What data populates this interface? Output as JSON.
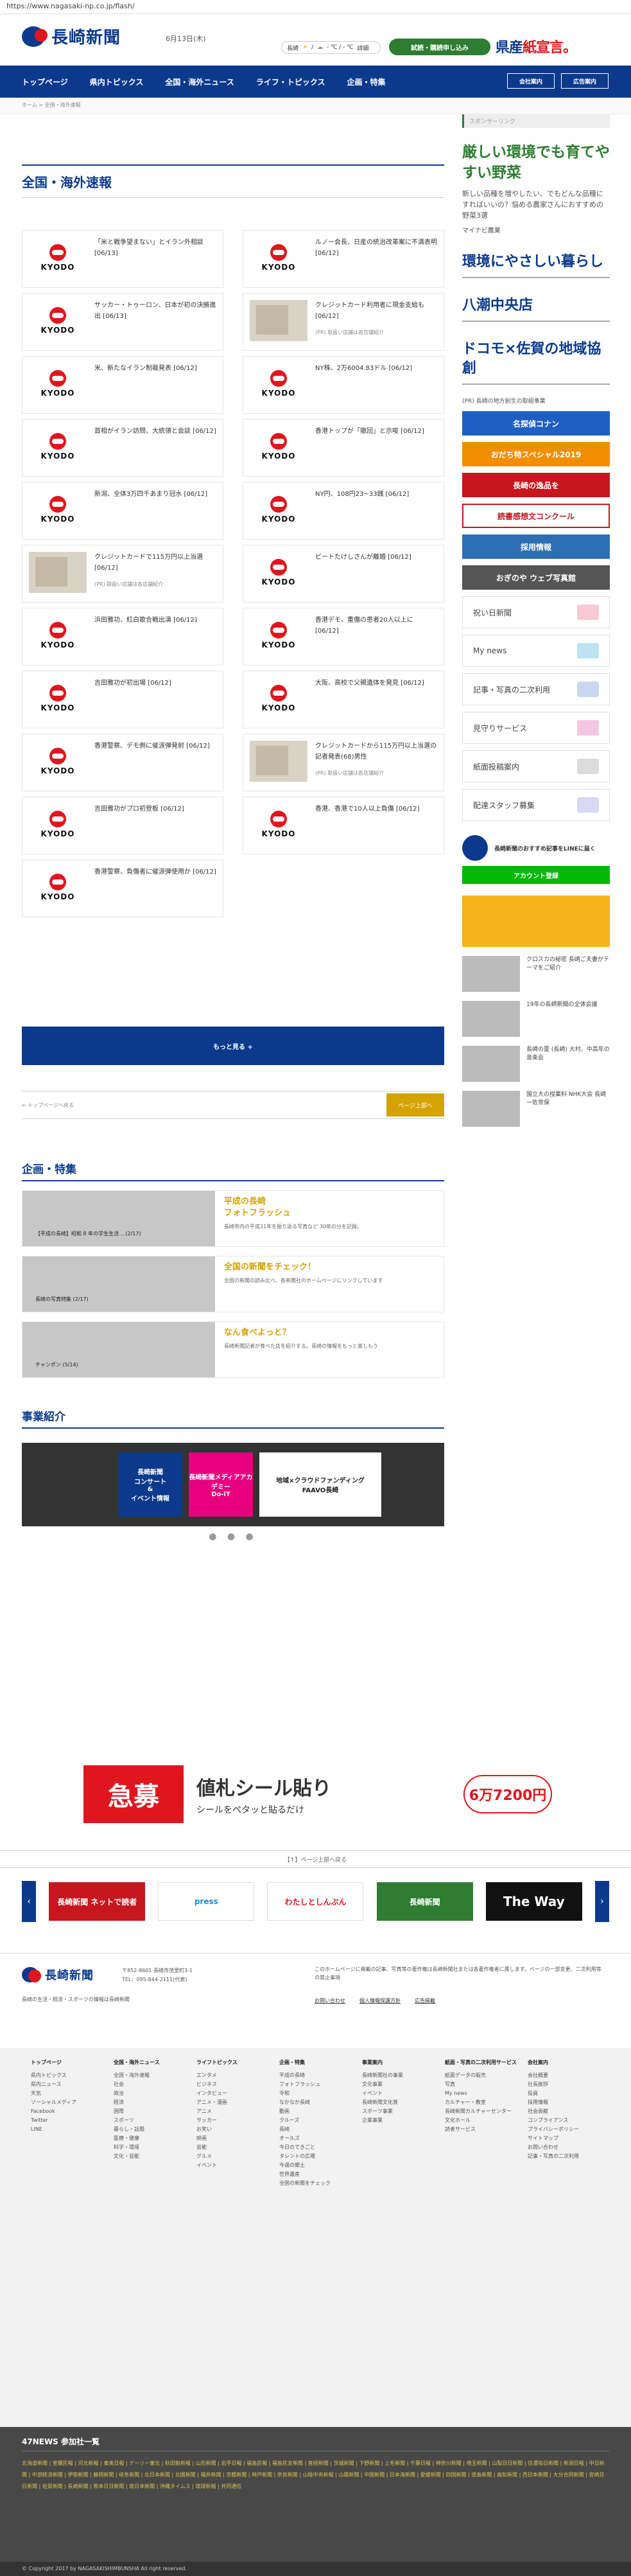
{
  "browser": {
    "url": "https://www.nagasaki-np.co.jp/flash/"
  },
  "header": {
    "logo": "長崎新聞",
    "date": "6月13日(木)",
    "weather": {
      "city": "長崎",
      "sun": "☀",
      "sep": "/",
      "cloud": "☁",
      "temp": "- ℃ / - ℃",
      "link": "詳細"
    },
    "trial": "試読・購読申し込み",
    "kenyo_a": "県産",
    "kenyo_b": "紙宣言。"
  },
  "nav": {
    "items": [
      "トップページ",
      "県内トピックス",
      "全国・海外ニュース",
      "ライフ・トピックス",
      "企画・特集"
    ],
    "company": "会社案内",
    "ad_info": "広告案内"
  },
  "breadcrumb": "ホーム > 全国・海外速報",
  "section": {
    "title": "全国・海外速報"
  },
  "kyodo_word": "KYODO",
  "articles": [
    {
      "title": "「米と戦争望まない」とイラン外相談 [06/13]",
      "kind": "kyodo"
    },
    {
      "title": "ルノー会長、日産の統治改革案に不満表明 [06/12]",
      "kind": "kyodo"
    },
    {
      "title": "サッカー・トゥーロン、日本が初の決勝進出 [06/13]",
      "kind": "kyodo"
    },
    {
      "title": "クレジットカード利用者に現金支給も [06/12]",
      "kind": "photo",
      "note": "(PR) 取扱い店舗は各店舗紹介"
    },
    {
      "title": "米、新たなイラン制裁発表 [06/12]",
      "kind": "kyodo"
    },
    {
      "title": "NY株、2万6004.83ドル [06/12]",
      "kind": "kyodo"
    },
    {
      "title": "首相がイラン訪問、大統領と会談 [06/12]",
      "kind": "kyodo"
    },
    {
      "title": "香港トップが「撤回」と示唆 [06/12]",
      "kind": "kyodo"
    },
    {
      "title": "新潟、全体3万四千あまり冠水 [06/12]",
      "kind": "kyodo"
    },
    {
      "title": "NY円、108円23~33銭 [06/12]",
      "kind": "kyodo"
    },
    {
      "title": "クレジットカードで115万円以上当選 [06/12]",
      "kind": "photo",
      "note": "(PR) 取扱い店舗は各店舗紹介"
    },
    {
      "title": "ビートたけしさんが離婚 [06/12]",
      "kind": "kyodo"
    },
    {
      "title": "浜田雅功、紅白歌合戦出演 [06/12]",
      "kind": "kyodo"
    },
    {
      "title": "香港デモ、重傷の患者20人以上に [06/12]",
      "kind": "kyodo"
    },
    {
      "title": "吉田雅功が初出場 [06/12]",
      "kind": "kyodo"
    },
    {
      "title": "大阪、高校で父親遺体を発見 [06/12]",
      "kind": "kyodo"
    },
    {
      "title": "香港警察、デモ側に催涙弾発射 [06/12]",
      "kind": "kyodo"
    },
    {
      "title": "クレジットカードから115万円以上当選の記者発表(68)男性",
      "kind": "photo",
      "note": "(PR) 取扱い店舗は各店舗紹介"
    },
    {
      "title": "吉田雅功がプロ初登板 [06/12]",
      "kind": "kyodo"
    },
    {
      "title": "香港、香港で10人以上負傷 [06/12]",
      "kind": "kyodo"
    },
    {
      "title": "香港警察、負傷者に催涙弾使用か [06/12]",
      "kind": "kyodo"
    }
  ],
  "more_label": "もっと見る +",
  "back_label": "← トップページへ戻る",
  "pagetop_label": "ページ上部へ",
  "feature": {
    "title": "企画・特集",
    "items": [
      {
        "cap": "【平成の長崎】昭和 8 年の学生生活 ...(2/17)",
        "title": "平成の長崎\nフォトフラッシュ",
        "sub": "長崎市内の平成31年を振り返る写真など 30年の分を記録。"
      },
      {
        "cap": "長崎の写真特集 (2/17)",
        "title": "全国の新聞をチェック！",
        "sub": "全国の新聞の読み比べ、各新聞社のホームページにリンクしています"
      },
      {
        "cap": "チャンポン (5/14)",
        "title": "なん食べよっと？",
        "sub": "長崎新聞記者が食べた店を紹介する。長崎の情報をもっと楽しもう"
      }
    ]
  },
  "business": {
    "title": "事業紹介",
    "b1": "長崎新聞\nコンサート\n&\nイベント情報",
    "b2": "長崎新聞メディアアカデミー\nDo-iT",
    "b3": "地域×クラウドファンディング\nFAAVO長崎"
  },
  "sidebar": {
    "sponsored": "スポンサーリンク",
    "ad_title": "厳しい環境でも育てやすい野菜",
    "ad_body": "新しい品種を増やしたい、でもどんな品種にすればいいの？悩める農家さんにおすすめの野菜3選",
    "ad_src": "マイナビ農業",
    "ads": [
      "環境にやさしい暮らし",
      "八潮中央店",
      "ドコモ×佐賀の地域協創"
    ],
    "pr": "(PR) 長崎の地方創生の取組事業",
    "small_ads": [
      "名探偵コナン",
      "おだち特スペシャル2019",
      "長崎の逸品を",
      "読書感想文コンクール",
      "採用情報",
      "おぎのや ウェブ写真館"
    ],
    "services": [
      "祝い日新聞",
      "My news",
      "記事・写真の二次利用",
      "見守りサービス",
      "紙面投稿案内",
      "配達スタッフ募集"
    ],
    "line_text": "長崎新聞のおすすめ記事をLINEに届く",
    "line_btn": "アカウント登録",
    "news": [
      {
        "text": "クロスカの秘密 長崎ご夫妻がテーマをご紹介"
      },
      {
        "text": "19年の長崎新聞の全体会議"
      },
      {
        "text": "長崎の夏 (長崎) 大村、中高年の音楽会"
      },
      {
        "text": "国立大の授業料 NHK大会 長崎ー佐世保"
      }
    ]
  },
  "bigad": {
    "left": "急募",
    "main": "値札シール貼り",
    "sub": "シールをペタッと貼るだけ",
    "right": "6万7200円"
  },
  "ftbar": "【↑】ページ上部へ戻る",
  "carousel": [
    "長崎新聞 ネットで読者",
    "press",
    "わたしとしんぶん",
    "長崎新聞",
    "The Way"
  ],
  "footer": {
    "addr": "〒852-8601 長崎市茂里町3-1\nTEL：095-844-2111(代表)",
    "note": "長崎の生活・経済・スポーツの情報は長崎新聞",
    "copy": "このホームページに掲載の記事、写真等の著作権は長崎新聞社または各著作権者に属します。ページの一部変更、二次利用等の禁止事項",
    "l1": "お問い合わせ",
    "l2": "個人情報保護方針",
    "l3": "広告掲載"
  },
  "sitemap": [
    {
      "h": "トップページ",
      "items": [
        "県内トピックス",
        "県内ニュース",
        "天気",
        "ソーシャルメディア",
        "Facebook",
        "Twitter",
        "LINE"
      ]
    },
    {
      "h": "全国・海外ニュース",
      "items": [
        "全国・海外速報",
        "社会",
        "政治",
        "経済",
        "国際",
        "スポーツ",
        "暮らし・話題",
        "医療・健康",
        "科学・環境",
        "文化・芸能"
      ]
    },
    {
      "h": "ライフトピックス",
      "items": [
        "エンタメ",
        "ビジネス",
        "インタビュー",
        "アニメ・漫画",
        "アニメ",
        "サッカー",
        "お笑い",
        "映画",
        "芸能",
        "グルメ",
        "イベント"
      ]
    },
    {
      "h": "企画・特集",
      "items": [
        "平成の長崎",
        "フォトフラッシュ",
        "令和",
        "なかなか長崎",
        "動画",
        "クルーズ",
        "長崎",
        "オールズ",
        "今日のできごと",
        "タレントの広場",
        "今週の郷土",
        "世界遺産",
        "全国の新聞をチェック"
      ]
    },
    {
      "h": "事業案内",
      "items": [
        "長崎新聞社の事業",
        "文化事業",
        "イベント",
        "長崎新聞文化賞",
        "スポーツ事業",
        "企業事業"
      ]
    },
    {
      "h": "紙面・写真の二次利用サービス",
      "items": [
        "紙面データの販売",
        "写真",
        "My news",
        "カルチャー・教室",
        "長崎新聞カルチャーセンター",
        "文化ホール",
        "読者サービス"
      ]
    },
    {
      "h": "会社案内",
      "items": [
        "会社概要",
        "社長挨拶",
        "役員",
        "採用情報",
        "社会貢献",
        "コンプライアンス",
        "プライバシーポリシー",
        "サイトマップ",
        "お問い合わせ",
        "記事・写真の二次利用"
      ]
    }
  ],
  "f47": {
    "title": "47NEWS 参加社一覧",
    "list": "北海道新聞 | 室蘭民報 | 河北新報 | 東奥日報 | デーリー東北 | 秋田魁新報 | 山形新聞 | 岩手日報 | 福島民報 | 福島民友新聞 | 産経新聞 | 茨城新聞 | 下野新聞 | 上毛新聞 | 千葉日報 | 神奈川新聞 | 埼玉新聞 | 山梨日日新聞 | 信濃毎日新聞 | 新潟日報 | 中日新聞 | 中部経済新聞 | 伊勢新聞 | 静岡新聞 | 岐阜新聞 | 北日本新聞 | 北國新聞 | 福井新聞 | 京都新聞 | 神戸新聞 | 奈良新聞 | 山陰中央新報 | 山陽新聞 | 中国新聞 | 日本海新聞 | 愛媛新聞 | 四国新聞 | 徳島新聞 | 高知新聞 | 西日本新聞 | 大分合同新聞 | 宮崎日日新聞 | 佐賀新聞 | 長崎新聞 | 熊本日日新聞 | 南日本新聞 | 沖縄タイムス | 琉球新報 | 共同通信"
  },
  "copyright": "© Copyright 2017 by NAGASAKISHIMBUNSHA  All right reserved."
}
